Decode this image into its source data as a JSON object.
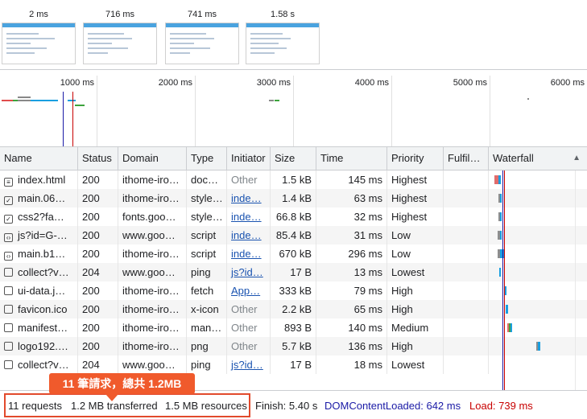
{
  "filmstrip": [
    {
      "time": "2 ms"
    },
    {
      "time": "716 ms"
    },
    {
      "time": "741 ms"
    },
    {
      "time": "1.58 s"
    }
  ],
  "overview_ticks": [
    "1000 ms",
    "2000 ms",
    "3000 ms",
    "4000 ms",
    "5000 ms",
    "6000 ms"
  ],
  "columns": {
    "name": "Name",
    "status": "Status",
    "domain": "Domain",
    "type": "Type",
    "initiator": "Initiator",
    "size": "Size",
    "time": "Time",
    "priority": "Priority",
    "fulfilled": "Fulfil…",
    "waterfall": "Waterfall"
  },
  "rows": [
    {
      "name": "index.html",
      "icon": "document-icon",
      "status": "200",
      "domain": "ithome-iro…",
      "type": "doc…",
      "initiator": "Other",
      "initiator_link": false,
      "size": "1.5 kB",
      "time": "145 ms",
      "priority": "Highest"
    },
    {
      "name": "main.06…",
      "icon": "stylesheet-icon",
      "status": "200",
      "domain": "ithome-iro…",
      "type": "style…",
      "initiator": "inde…",
      "initiator_link": true,
      "size": "1.4 kB",
      "time": "63 ms",
      "priority": "Highest"
    },
    {
      "name": "css2?fa…",
      "icon": "stylesheet-icon",
      "status": "200",
      "domain": "fonts.goo…",
      "type": "style…",
      "initiator": "inde…",
      "initiator_link": true,
      "size": "66.8 kB",
      "time": "32 ms",
      "priority": "Highest"
    },
    {
      "name": "js?id=G-…",
      "icon": "script-icon",
      "status": "200",
      "domain": "www.goo…",
      "type": "script",
      "initiator": "inde…",
      "initiator_link": true,
      "size": "85.4 kB",
      "time": "31 ms",
      "priority": "Low"
    },
    {
      "name": "main.b1…",
      "icon": "script-icon",
      "status": "200",
      "domain": "ithome-iro…",
      "type": "script",
      "initiator": "inde…",
      "initiator_link": true,
      "size": "670 kB",
      "time": "296 ms",
      "priority": "Low"
    },
    {
      "name": "collect?v…",
      "icon": "blank-file-icon",
      "status": "204",
      "domain": "www.goo…",
      "type": "ping",
      "initiator": "js?id…",
      "initiator_link": true,
      "size": "17 B",
      "time": "13 ms",
      "priority": "Lowest"
    },
    {
      "name": "ui-data.j…",
      "icon": "blank-file-icon",
      "status": "200",
      "domain": "ithome-iro…",
      "type": "fetch",
      "initiator": "App…",
      "initiator_link": true,
      "size": "333 kB",
      "time": "79 ms",
      "priority": "High"
    },
    {
      "name": "favicon.ico",
      "icon": "blank-file-icon",
      "status": "200",
      "domain": "ithome-iro…",
      "type": "x-icon",
      "initiator": "Other",
      "initiator_link": false,
      "size": "2.2 kB",
      "time": "65 ms",
      "priority": "High"
    },
    {
      "name": "manifest…",
      "icon": "blank-file-icon",
      "status": "200",
      "domain": "ithome-iro…",
      "type": "man…",
      "initiator": "Other",
      "initiator_link": false,
      "size": "893 B",
      "time": "140 ms",
      "priority": "Medium"
    },
    {
      "name": "logo192.…",
      "icon": "blank-file-icon",
      "status": "200",
      "domain": "ithome-iro…",
      "type": "png",
      "initiator": "Other",
      "initiator_link": false,
      "size": "5.7 kB",
      "time": "136 ms",
      "priority": "High"
    },
    {
      "name": "collect?v…",
      "icon": "blank-file-icon",
      "status": "204",
      "domain": "www.goo…",
      "type": "ping",
      "initiator": "js?id…",
      "initiator_link": true,
      "size": "17 B",
      "time": "18 ms",
      "priority": "Lowest"
    }
  ],
  "status_bar": {
    "requests": "11 requests",
    "transferred": "1.2 MB transferred",
    "resources": "1.5 MB resources",
    "finish": "Finish: 5.40 s",
    "dom_content_loaded": "DOMContentLoaded: 642 ms",
    "load": "Load: 739 ms"
  },
  "callout": "11 筆請求，總共 1.2MB",
  "colors": {
    "dcl": "#1a1aa6",
    "load": "#c80000",
    "callout": "#f05a2c",
    "link": "#1a53b0"
  }
}
